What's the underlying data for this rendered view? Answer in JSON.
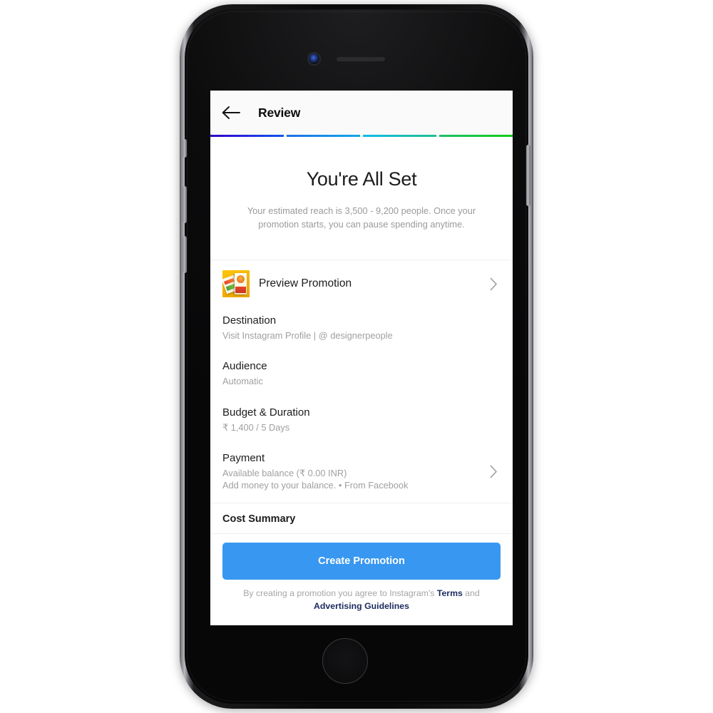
{
  "device": {
    "type": "smartphone-mockup",
    "camera_icon": "front-camera",
    "speaker_icon": "earpiece-speaker",
    "home_button_icon": "home-button"
  },
  "header": {
    "back_icon": "back-arrow-icon",
    "title": "Review"
  },
  "progress": {
    "segments": [
      {
        "name": "step-1",
        "from": "#3300cc",
        "to": "#1155ee"
      },
      {
        "name": "step-2",
        "from": "#1e6ee8",
        "to": "#11a8e8"
      },
      {
        "name": "step-3",
        "from": "#10bbe8",
        "to": "#1fbf8f"
      },
      {
        "name": "step-4",
        "from": "#1cc06a",
        "to": "#14cc14"
      }
    ]
  },
  "hero": {
    "title": "You're All Set",
    "subtitle": "Your estimated reach is 3,500 - 9,200 people. Once your promotion starts, you can pause spending anytime."
  },
  "preview": {
    "thumbnail_icon": "promotion-thumbnail",
    "label": "Preview Promotion",
    "chevron_icon": "chevron-right-icon"
  },
  "details": [
    {
      "name": "destination",
      "title": "Destination",
      "sub": "Visit Instagram Profile | @ designerpeople",
      "chevron": false
    },
    {
      "name": "audience",
      "title": "Audience",
      "sub": "Automatic",
      "chevron": false
    },
    {
      "name": "budget-duration",
      "title": "Budget & Duration",
      "sub": "₹ 1,400 / 5 Days",
      "chevron": false
    },
    {
      "name": "payment",
      "title": "Payment",
      "sub": "Available balance (₹ 0.00 INR)",
      "sub2": "Add money to your balance. • From Facebook",
      "chevron": true
    }
  ],
  "cost_summary": {
    "title": "Cost Summary"
  },
  "cta": {
    "label": "Create Promotion",
    "color": "#3897f0"
  },
  "legal": {
    "prefix": "By creating a promotion you agree to Instagram's ",
    "terms_link": "Terms",
    "middle": " and ",
    "guidelines_link": "Advertising Guidelines",
    "link_color": "#1b2a5e"
  }
}
